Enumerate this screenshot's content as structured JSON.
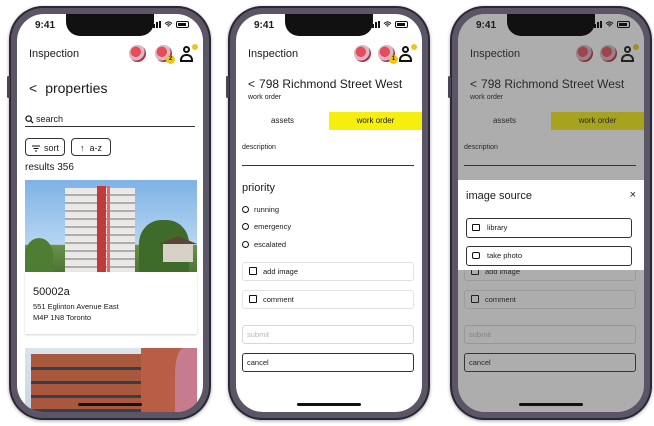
{
  "status": {
    "time": "9:41"
  },
  "phone1": {
    "app_title": "Inspection",
    "badge_count": "2",
    "page_title": "properties",
    "search_label": "search",
    "sort_label": "sort",
    "az_label": "a-z",
    "results_label": "results 356",
    "property": {
      "id": "50002a",
      "address_line1": "551 Eglinton Avenue East",
      "address_line2": "M4P 1N8 Toronto"
    }
  },
  "phone2": {
    "app_title": "Inspection",
    "badge_count": "1",
    "address": "798 Richmond Street West",
    "work_order_label": "work order",
    "tabs": [
      {
        "label": "assets"
      },
      {
        "label": "work order"
      }
    ],
    "description_label": "description",
    "priority_title": "priority",
    "priority_options": [
      {
        "label": "running"
      },
      {
        "label": "emergency"
      },
      {
        "label": "escalated"
      }
    ],
    "add_image_label": "add image",
    "comment_label": "comment",
    "submit_label": "submit",
    "cancel_label": "cancel"
  },
  "phone3": {
    "app_title": "Inspection",
    "address": "798 Richmond Street West",
    "work_order_label": "work order",
    "tabs": [
      {
        "label": "assets"
      },
      {
        "label": "work order"
      }
    ],
    "description_label": "description",
    "add_image_label": "add image",
    "comment_label": "comment",
    "submit_label": "submit",
    "cancel_label": "cancel",
    "dialog": {
      "title": "image source",
      "close": "×",
      "options": [
        {
          "label": "library"
        },
        {
          "label": "take photo"
        }
      ]
    }
  },
  "colors": {
    "accent_yellow": "#f6ee0c",
    "frame": "#2b2734",
    "overlay": "#5a5a5a"
  },
  "icons": [
    "chevron-left-icon",
    "search-icon",
    "sort-icon",
    "arrow-up-icon",
    "user-icon",
    "image-icon",
    "comment-icon",
    "camera-icon",
    "close-icon",
    "radio-icon"
  ]
}
